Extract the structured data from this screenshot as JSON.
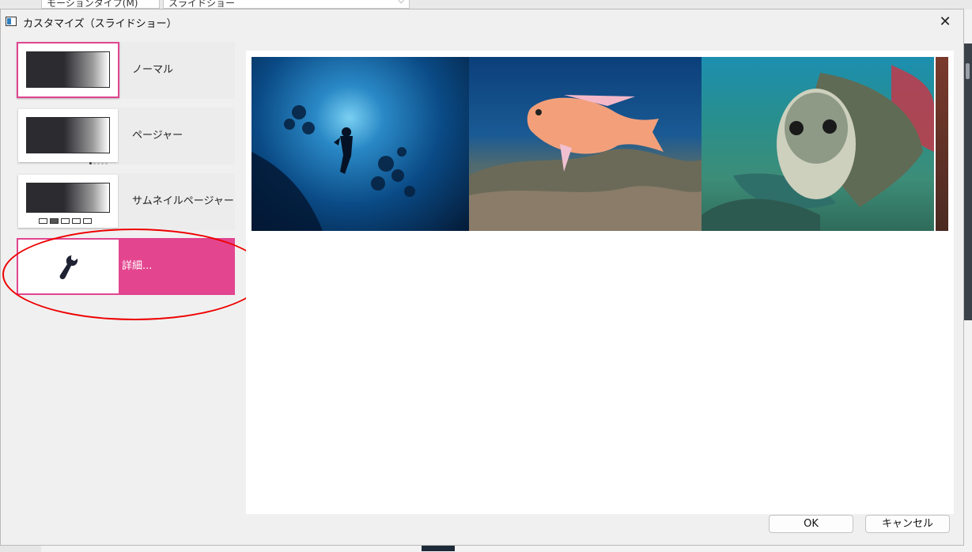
{
  "background": {
    "field1_text": "モーションタイプ(M)",
    "field2_text": "スライドショー"
  },
  "dialog": {
    "title": "カスタマイズ（スライドショー）",
    "close_glyph": "✕"
  },
  "styles": [
    {
      "label": "ノーマル",
      "selected": true,
      "indicator": "none"
    },
    {
      "label": "ページャー",
      "selected": false,
      "indicator": "dots"
    },
    {
      "label": "サムネイルページャー",
      "selected": false,
      "indicator": "thumbnails"
    },
    {
      "label": "詳細...",
      "selected": false,
      "indicator": "wrench-icon"
    }
  ],
  "preview": {
    "images": [
      "diver-silhouette",
      "orange-anthias-fish",
      "sea-turtle",
      "coral-edge"
    ]
  },
  "buttons": {
    "ok": "OK",
    "cancel": "キャンセル"
  },
  "colors": {
    "accent": "#e3468f",
    "annotation": "#e00000"
  }
}
